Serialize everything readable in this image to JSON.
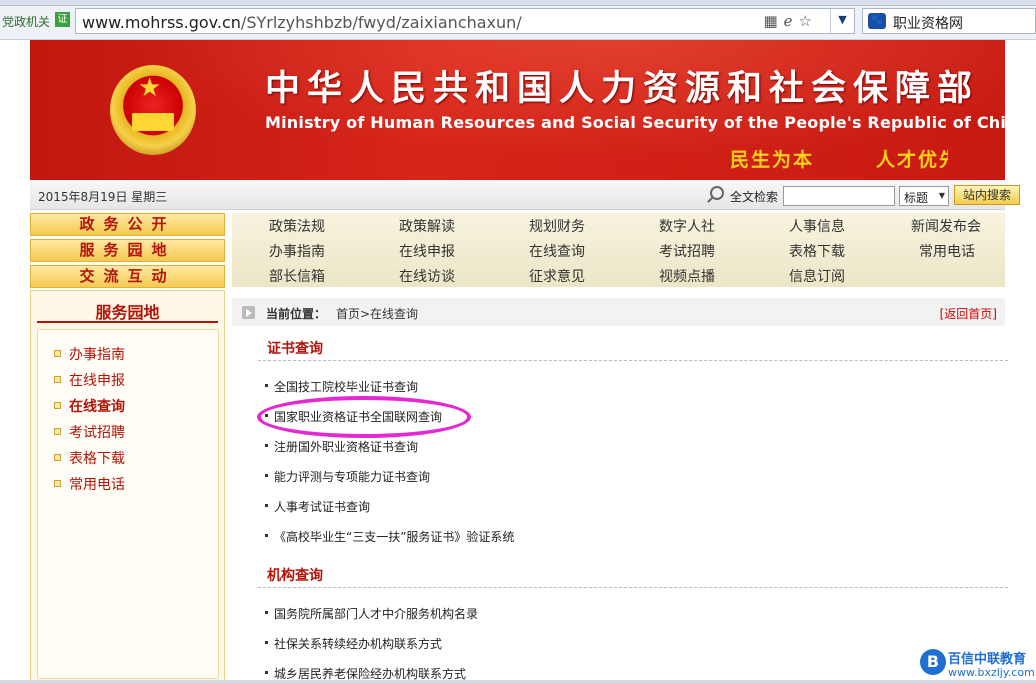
{
  "browser": {
    "zone_label": "党政机关",
    "cert_label": "证",
    "url_host": "www.mohrss.gov.cn",
    "url_path": "/SYrlzyhshbzb/fwyd/zaixianchaxun/",
    "search_engine_label": "职业资格网"
  },
  "banner": {
    "title_cn": "中华人民共和国人力资源和社会保障部",
    "title_en": "Ministry of Human Resources and Social Security of the People's Republic of China",
    "slogan_1": "民生为本",
    "slogan_2": "人才优先"
  },
  "info_bar": {
    "date": "2015年8月19日 星期三",
    "fulltext_label": "全文检索",
    "keyword_value": "",
    "scope_value": "标题",
    "search_button": "站内搜索"
  },
  "left_tabs": [
    "政务公开",
    "服务园地",
    "交流互动"
  ],
  "side_panel": {
    "title": "服务园地",
    "items": [
      {
        "label": "办事指南",
        "active": false
      },
      {
        "label": "在线申报",
        "active": false
      },
      {
        "label": "在线查询",
        "active": true
      },
      {
        "label": "考试招聘",
        "active": false
      },
      {
        "label": "表格下载",
        "active": false
      },
      {
        "label": "常用电话",
        "active": false
      }
    ]
  },
  "top_menu": {
    "row1": [
      "政策法规",
      "政策解读",
      "规划财务",
      "数字人社",
      "人事信息",
      "新闻发布会"
    ],
    "row2": [
      "办事指南",
      "在线申报",
      "在线查询",
      "考试招聘",
      "表格下载",
      "常用电话"
    ],
    "row3": [
      "部长信箱",
      "在线访谈",
      "征求意见",
      "视频点播",
      "信息订阅"
    ]
  },
  "breadcrumb": {
    "label": "当前位置：",
    "path": "首页>在线查询",
    "back_home": "[返回首页]"
  },
  "sections": [
    {
      "title": "证书查询",
      "links": [
        "全国技工院校毕业证书查询",
        "国家职业资格证书全国联网查询",
        "注册国外职业资格证书查询",
        "能力评测与专项能力证书查询",
        "人事考试证书查询",
        "《高校毕业生“三支一扶”服务证书》验证系统"
      ]
    },
    {
      "title": "机构查询",
      "links": [
        "国务院所属部门人才中介服务机构名录",
        "社保关系转续经办机构联系方式",
        "城乡居民养老保险经办机构联系方式"
      ]
    }
  ],
  "watermark": {
    "logo": "B",
    "name": "百信中联教育",
    "url": "www.bxzljy.com"
  }
}
